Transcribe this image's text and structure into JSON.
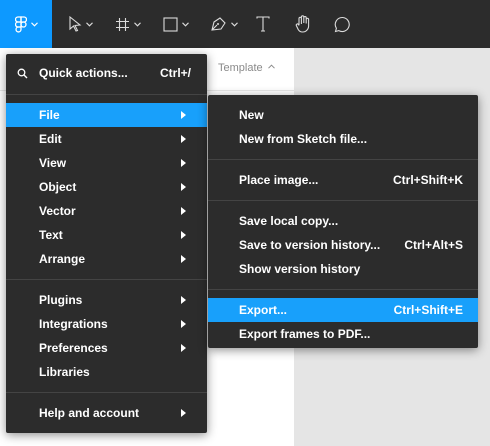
{
  "toolbar": {
    "accent": "#0d99ff",
    "background": "#2c2c2c",
    "tools": [
      {
        "name": "main-menu-tool",
        "icon": "figma-logo-icon",
        "active": true
      },
      {
        "name": "move-tool",
        "icon": "cursor-arrow-icon"
      },
      {
        "name": "frame-tool",
        "icon": "frame-hash-icon"
      },
      {
        "name": "shape-tool",
        "icon": "rectangle-icon"
      },
      {
        "name": "pen-tool",
        "icon": "pen-nib-icon"
      },
      {
        "name": "text-tool",
        "icon": "text-T-icon"
      },
      {
        "name": "hand-tool",
        "icon": "hand-icon"
      },
      {
        "name": "comment-tool",
        "icon": "comment-bubble-icon"
      }
    ]
  },
  "panel": {
    "template_label": "Template"
  },
  "main_menu": {
    "items": [
      {
        "label": "Quick actions...",
        "shortcut": "Ctrl+/",
        "icon": "search-icon"
      },
      {
        "label": "File",
        "has_submenu": true,
        "selected": true
      },
      {
        "label": "Edit",
        "has_submenu": true
      },
      {
        "label": "View",
        "has_submenu": true
      },
      {
        "label": "Object",
        "has_submenu": true
      },
      {
        "label": "Vector",
        "has_submenu": true
      },
      {
        "label": "Text",
        "has_submenu": true
      },
      {
        "label": "Arrange",
        "has_submenu": true
      },
      {
        "label": "Plugins",
        "has_submenu": true
      },
      {
        "label": "Integrations",
        "has_submenu": true
      },
      {
        "label": "Preferences",
        "has_submenu": true
      },
      {
        "label": "Libraries"
      },
      {
        "label": "Help and account",
        "has_submenu": true
      }
    ]
  },
  "file_submenu": {
    "items": [
      {
        "label": "New",
        "shortcut": ""
      },
      {
        "label": "New from Sketch file...",
        "shortcut": ""
      },
      {
        "label": "Place image...",
        "shortcut": "Ctrl+Shift+K"
      },
      {
        "label": "Save local copy...",
        "shortcut": ""
      },
      {
        "label": "Save to version history...",
        "shortcut": "Ctrl+Alt+S"
      },
      {
        "label": "Show version history",
        "shortcut": ""
      },
      {
        "label": "Export...",
        "shortcut": "Ctrl+Shift+E",
        "selected": true
      },
      {
        "label": "Export frames to PDF...",
        "shortcut": ""
      }
    ]
  },
  "colors": {
    "menu_bg": "#2c2c2c",
    "highlight": "#18a0fb",
    "separator": "#444444"
  }
}
